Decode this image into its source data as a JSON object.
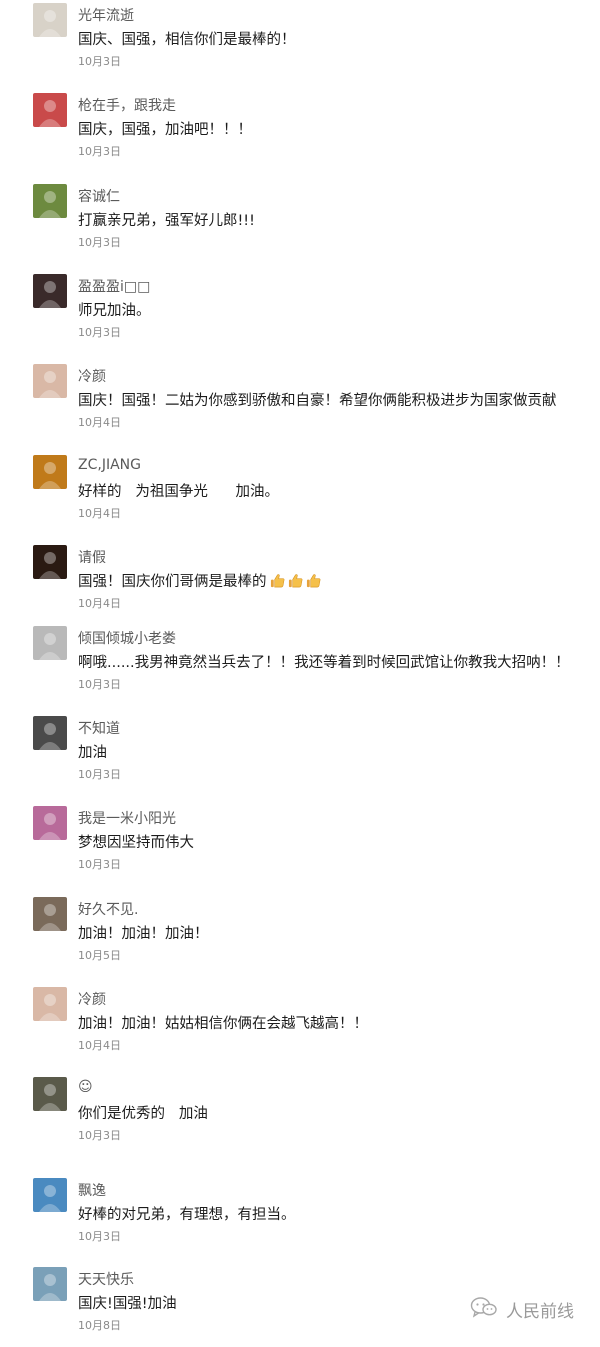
{
  "comments": [
    {
      "name": "光年流逝",
      "text": "国庆、国强，相信你们是最棒的！",
      "date": "10月3日",
      "avatar_color": "#d8d2c8"
    },
    {
      "name": "枪在手，跟我走",
      "text": "国庆，国强，加油吧！！！",
      "date": "10月3日",
      "avatar_color": "#c94a4a"
    },
    {
      "name": "容诚仁",
      "text": "打赢亲兄弟，强军好儿郎!!!",
      "date": "10月3日",
      "avatar_color": "#6d8a3f"
    },
    {
      "name": "盈盈盈i□□",
      "text": "师兄加油。",
      "date": "10月3日",
      "avatar_color": "#3a2a2a"
    },
    {
      "name": "冷颜",
      "text": "国庆！国强！二姑为你感到骄傲和自豪！希望你俩能积极进步为国家做贡献",
      "date": "10月4日",
      "avatar_color": "#d9b8a6"
    },
    {
      "name": "ZC,JIANG",
      "text": "好样的   为祖国争光      加油。",
      "date": "10月4日",
      "avatar_color": "#c07a1a"
    },
    {
      "name": "请假",
      "text": "国强！国庆你们哥俩是最棒的",
      "date": "10月4日",
      "avatar_color": "#2a1a12",
      "thumbs": 3
    },
    {
      "name": "倾国倾城小老娄",
      "text": "啊哦......我男神竟然当兵去了！！我还等着到时候回武馆让你教我大招呐！！",
      "date": "10月3日",
      "avatar_color": "#b9b9b9"
    },
    {
      "name": "不知道",
      "text": "加油",
      "date": "10月3日",
      "avatar_color": "#4a4a4a"
    },
    {
      "name": "我是一米小阳光",
      "text": "梦想因坚持而伟大",
      "date": "10月3日",
      "avatar_color": "#b86a9a"
    },
    {
      "name": "好久不见.",
      "text": "加油！加油！加油！",
      "date": "10月5日",
      "avatar_color": "#7a6a5a"
    },
    {
      "name": "冷颜",
      "text": "加油！加油！姑姑相信你俩在会越飞越高！！",
      "date": "10月4日",
      "avatar_color": "#d9b8a6"
    },
    {
      "name": "☺",
      "text": "你们是优秀的   加油",
      "date": "10月3日",
      "avatar_color": "#5a5a4a"
    },
    {
      "name": "飘逸",
      "text": "好棒的对兄弟，有理想，有担当。",
      "date": "10月3日",
      "avatar_color": "#4a8ac0"
    },
    {
      "name": "天天快乐",
      "text": "国庆!国强!加油",
      "date": "10月8日",
      "avatar_color": "#7aa0b8"
    }
  ],
  "watermark": {
    "text": "人民前线",
    "icon": "wechat-icon"
  }
}
